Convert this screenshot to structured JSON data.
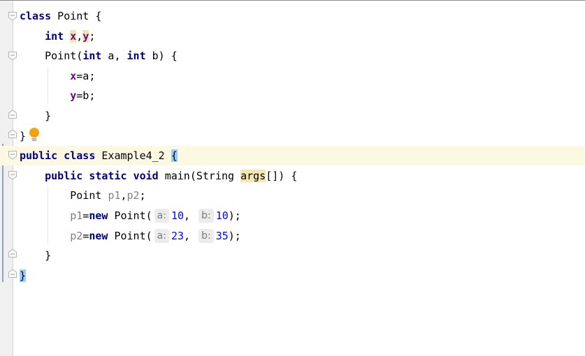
{
  "editor": {
    "language": "java",
    "lines": [
      {
        "tokens": [
          {
            "t": "class",
            "c": "kw"
          },
          {
            "t": " Point {",
            "c": "ident"
          }
        ]
      },
      {
        "tokens": [
          {
            "t": "    "
          },
          {
            "t": "int",
            "c": "kw"
          },
          {
            "t": " "
          },
          {
            "t": "x",
            "c": "field hl-usage"
          },
          {
            "t": ","
          },
          {
            "t": "y",
            "c": "field hl-usage"
          },
          {
            "t": ";"
          }
        ]
      },
      {
        "tokens": [
          {
            "t": "    Point("
          },
          {
            "t": "int",
            "c": "kw"
          },
          {
            "t": " a, "
          },
          {
            "t": "int",
            "c": "kw"
          },
          {
            "t": " b) {"
          }
        ]
      },
      {
        "tokens": [
          {
            "t": "        "
          },
          {
            "t": "x",
            "c": "field"
          },
          {
            "t": "=a;"
          }
        ]
      },
      {
        "tokens": [
          {
            "t": "        "
          },
          {
            "t": "y",
            "c": "field"
          },
          {
            "t": "=b;"
          }
        ]
      },
      {
        "tokens": [
          {
            "t": "    }"
          }
        ]
      },
      {
        "tokens": [
          {
            "t": "}"
          }
        ]
      },
      {
        "tokens": [
          {
            "t": "public",
            "c": "kw"
          },
          {
            "t": " "
          },
          {
            "t": "class",
            "c": "kw"
          },
          {
            "t": " Example4_2 "
          },
          {
            "t": "{",
            "c": "brace-match"
          }
        ]
      },
      {
        "tokens": [
          {
            "t": "    "
          },
          {
            "t": "public",
            "c": "kw"
          },
          {
            "t": " "
          },
          {
            "t": "static",
            "c": "kw"
          },
          {
            "t": " "
          },
          {
            "t": "void",
            "c": "kw"
          },
          {
            "t": " main(String "
          },
          {
            "t": "args",
            "c": "hl-usage"
          },
          {
            "t": "[]) {"
          }
        ]
      },
      {
        "tokens": [
          {
            "t": "        Point "
          },
          {
            "t": "p1",
            "c": "unused"
          },
          {
            "t": ","
          },
          {
            "t": "p2",
            "c": "unused"
          },
          {
            "t": ";"
          }
        ]
      },
      {
        "tokens": [
          {
            "t": "        "
          },
          {
            "t": "p1",
            "c": "unused"
          },
          {
            "t": "="
          },
          {
            "t": "new",
            "c": "kw"
          },
          {
            "t": " Point("
          },
          {
            "hint": "a:"
          },
          {
            "t": "10",
            "c": "num"
          },
          {
            "t": ", "
          },
          {
            "hint": "b:"
          },
          {
            "t": "10",
            "c": "num"
          },
          {
            "t": ");"
          }
        ]
      },
      {
        "tokens": [
          {
            "t": "        "
          },
          {
            "t": "p2",
            "c": "unused"
          },
          {
            "t": "="
          },
          {
            "t": "new",
            "c": "kw"
          },
          {
            "t": " Point("
          },
          {
            "hint": "a:"
          },
          {
            "t": "23",
            "c": "num"
          },
          {
            "t": ", "
          },
          {
            "hint": "b:"
          },
          {
            "t": "35",
            "c": "num"
          },
          {
            "t": ");"
          }
        ]
      },
      {
        "tokens": [
          {
            "t": "    }"
          }
        ]
      },
      {
        "tokens": [
          {
            "t": "}",
            "c": "brace-match"
          }
        ]
      }
    ],
    "current_line": 8,
    "intention_icon": "lightbulb-icon",
    "colors": {
      "keyword": "#000080",
      "field": "#660e7a",
      "number": "#0000ff",
      "unused": "#808080",
      "current_line_bg": "#fdf8e2",
      "brace_match_bg": "#99ccff",
      "usage_highlight_bg": "#f5e6b0",
      "bulb": "#f2a20c"
    }
  }
}
